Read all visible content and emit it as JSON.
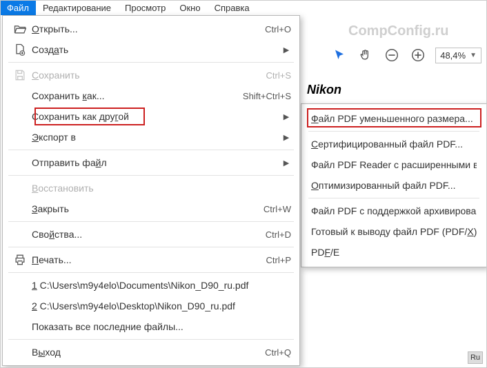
{
  "menubar": {
    "file": "Файл",
    "edit": "Редактирование",
    "view": "Просмотр",
    "window": "Окно",
    "help": "Справка"
  },
  "watermark": "CompConfig.ru",
  "brand": "Nikon",
  "toolbar": {
    "zoom_value": "48,4%"
  },
  "file_menu": {
    "open": "Открыть...",
    "open_accel": "Ctrl+O",
    "create": "Создать",
    "save": "Сохранить",
    "save_accel": "Ctrl+S",
    "save_as": "Сохранить как...",
    "save_as_accel": "Shift+Ctrl+S",
    "save_other": "Сохранить как другой",
    "export": "Экспорт в",
    "send": "Отправить файл",
    "revert": "Восстановить",
    "close": "Закрыть",
    "close_accel": "Ctrl+W",
    "properties": "Свойства...",
    "properties_accel": "Ctrl+D",
    "print": "Печать...",
    "print_accel": "Ctrl+P",
    "recent1": "1 C:\\Users\\m9y4elo\\Documents\\Nikon_D90_ru.pdf",
    "recent2": "2 C:\\Users\\m9y4elo\\Desktop\\Nikon_D90_ru.pdf",
    "show_recent": "Показать все последние файлы...",
    "exit": "Выход",
    "exit_accel": "Ctrl+Q"
  },
  "submenu": {
    "reduced": "Файл PDF уменьшенного размера...",
    "certified": "Сертифицированный файл PDF...",
    "reader": "Файл PDF Reader с расширенными возможностями",
    "optimized": "Оптимизированный файл PDF...",
    "archive": "Файл PDF с поддержкой архивирования",
    "print_ready": "Готовый к выводу файл PDF (PDF/X)",
    "pdfe": "PDF/E"
  },
  "ru_badge": "Ru"
}
